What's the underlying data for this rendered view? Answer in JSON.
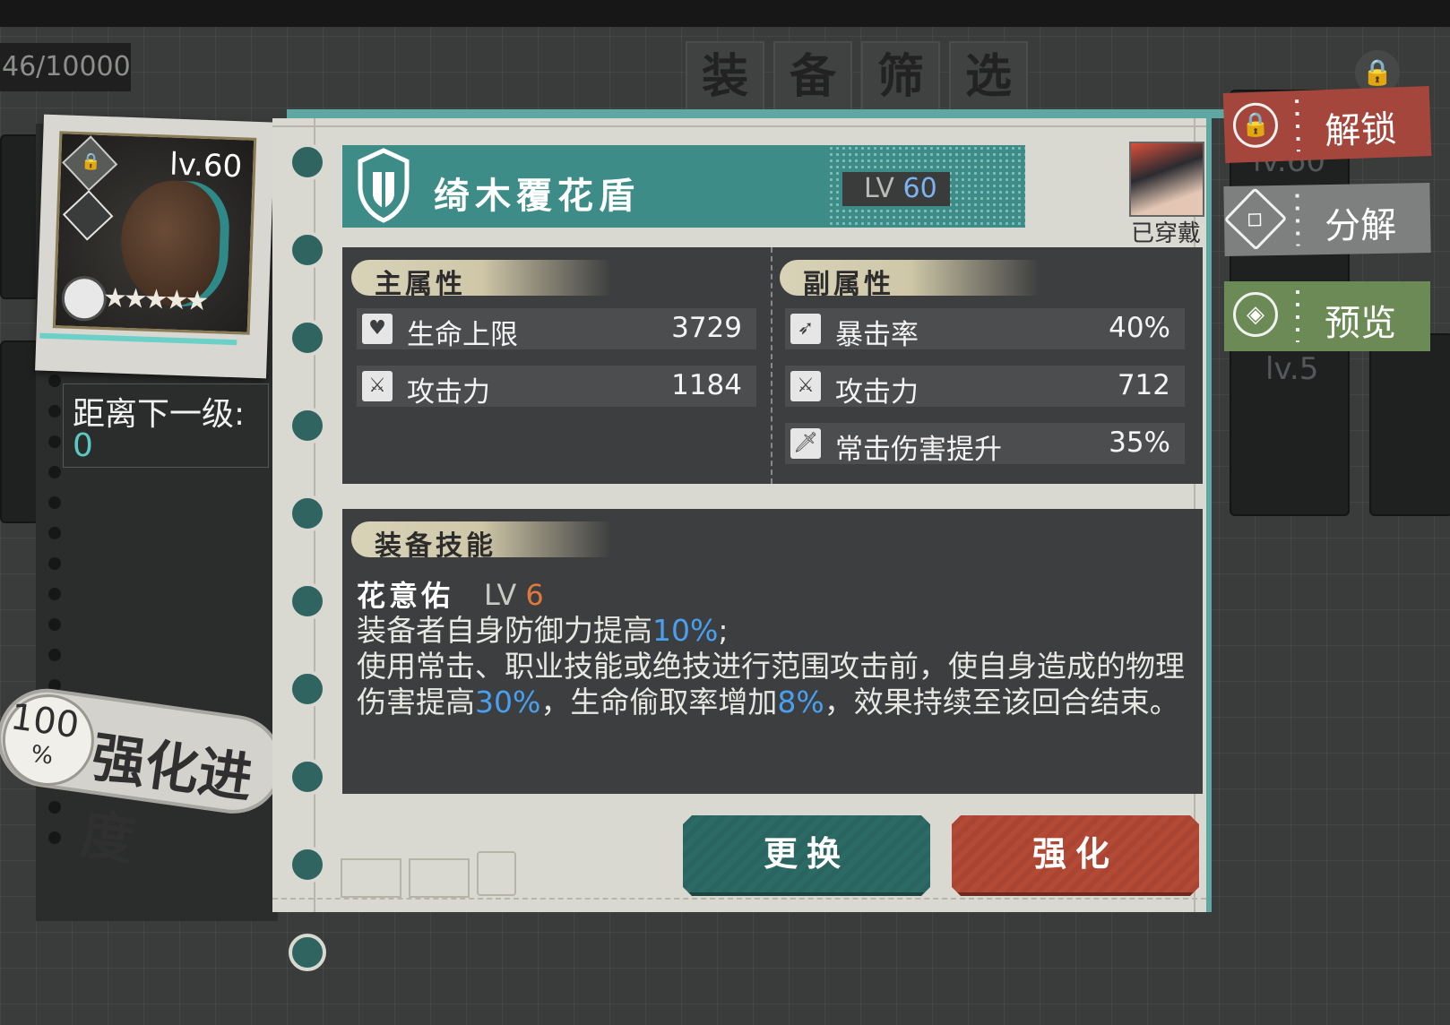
{
  "header": {
    "counter": "46/10000",
    "filter_title": [
      "装",
      "备",
      "筛",
      "选"
    ]
  },
  "background": {
    "card_levels": [
      "lv.60",
      "lv.5"
    ]
  },
  "left_panel": {
    "thumbnail_level": "lv.60",
    "stars": "★★★★★",
    "next_level_label": "距离下一级:",
    "next_level_value": "0",
    "progress_pct": "100",
    "progress_pct_sign": "%",
    "progress_label": "强化进度"
  },
  "equipment": {
    "name": "绮木覆花盾",
    "lv_prefix": "LV",
    "lv_value": "60",
    "worn_status": "已穿戴"
  },
  "main_stats": {
    "header": "主属性",
    "rows": [
      {
        "name": "生命上限",
        "value": "3729",
        "icon": "heart-icon"
      },
      {
        "name": "攻击力",
        "value": "1184",
        "icon": "crossed-swords-icon"
      }
    ]
  },
  "sub_stats": {
    "header": "副属性",
    "rows": [
      {
        "name": "暴击率",
        "value": "40%",
        "icon": "crit-arrow-icon"
      },
      {
        "name": "攻击力",
        "value": "712",
        "icon": "crossed-swords-icon"
      },
      {
        "name": "常击伤害提升",
        "value": "35%",
        "icon": "sword-icon"
      }
    ]
  },
  "skill": {
    "header": "装备技能",
    "name": "花意佑",
    "lv_prefix": "LV",
    "lv_value": "6",
    "desc_1a": "装备者自身防御力提高",
    "desc_1b": "10%",
    "desc_1c": ";",
    "desc_2a": "使用常击、职业技能或绝技进行范围攻击前，使自身造成的物理伤害提高",
    "desc_2b": "30%",
    "desc_2c": "，生命偷取率增加",
    "desc_2d": "8%",
    "desc_2e": "，效果持续至该回合结束。"
  },
  "buttons": {
    "replace": "更换",
    "enhance": "强化"
  },
  "actions": {
    "unlock": "解锁",
    "disassemble": "分解",
    "preview": "预览"
  },
  "colors": {
    "teal": "#3e8c87",
    "red": "#b34a36",
    "highlight_blue": "#4aa0f0",
    "level_orange": "#e07a3c"
  }
}
